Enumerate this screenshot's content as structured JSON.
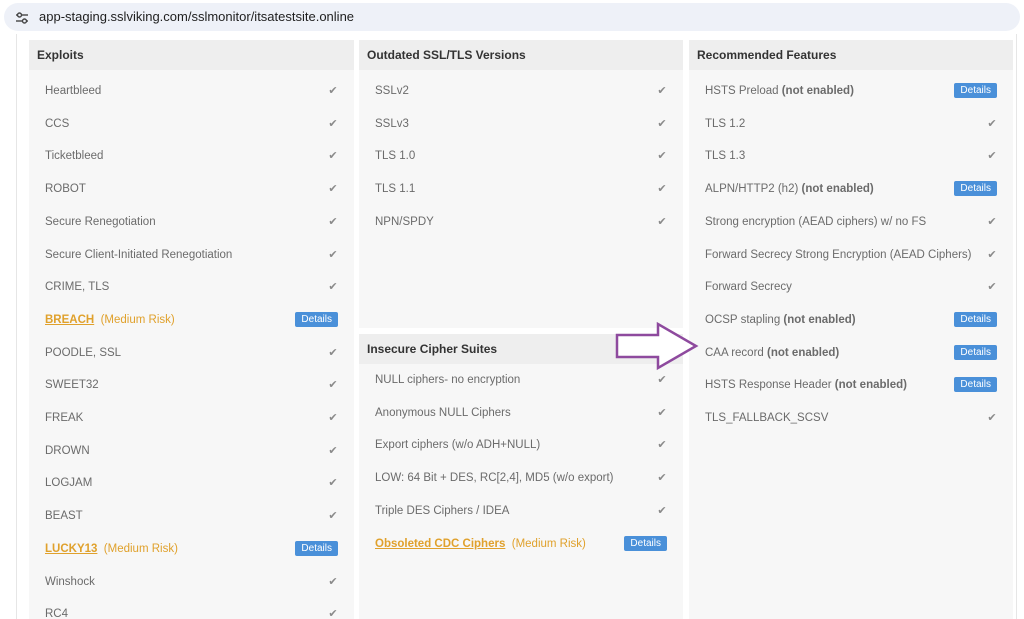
{
  "address_bar": {
    "url": "app-staging.sslviking.com/sslmonitor/itsatestsite.online"
  },
  "details_label": "Details",
  "exploits": {
    "title": "Exploits",
    "items": [
      {
        "label": "Heartbleed"
      },
      {
        "label": "CCS"
      },
      {
        "label": "Ticketbleed"
      },
      {
        "label": "ROBOT"
      },
      {
        "label": "Secure Renegotiation"
      },
      {
        "label": "Secure Client-Initiated Renegotiation"
      },
      {
        "label": "CRIME, TLS"
      },
      {
        "link": "BREACH",
        "risk": "(Medium Risk)"
      },
      {
        "label": "POODLE, SSL"
      },
      {
        "label": "SWEET32"
      },
      {
        "label": "FREAK"
      },
      {
        "label": "DROWN"
      },
      {
        "label": "LOGJAM"
      },
      {
        "label": "BEAST"
      },
      {
        "link": "LUCKY13",
        "risk": "(Medium Risk)"
      },
      {
        "label": "Winshock"
      },
      {
        "label": "RC4"
      }
    ]
  },
  "outdated": {
    "title": "Outdated SSL/TLS Versions",
    "items": [
      {
        "label": "SSLv2"
      },
      {
        "label": "SSLv3"
      },
      {
        "label": "TLS 1.0"
      },
      {
        "label": "TLS 1.1"
      },
      {
        "label": "NPN/SPDY"
      }
    ]
  },
  "insecure": {
    "title": "Insecure Cipher Suites",
    "items": [
      {
        "label": "NULL ciphers- no encryption"
      },
      {
        "label": "Anonymous NULL Ciphers"
      },
      {
        "label": "Export ciphers (w/o ADH+NULL)"
      },
      {
        "label": "LOW: 64 Bit + DES, RC[2,4], MD5 (w/o export)"
      },
      {
        "label": "Triple DES Ciphers / IDEA"
      },
      {
        "link": "Obsoleted CDC Ciphers",
        "risk": "(Medium Risk)"
      }
    ]
  },
  "recommended": {
    "title": "Recommended Features",
    "items": [
      {
        "label": "HSTS Preload",
        "status": "(not enabled)"
      },
      {
        "label": "TLS 1.2"
      },
      {
        "label": "TLS 1.3"
      },
      {
        "label": "ALPN/HTTP2 (h2)",
        "status": "(not enabled)"
      },
      {
        "label": "Strong encryption (AEAD ciphers) w/ no FS"
      },
      {
        "label": "Forward Secrecy Strong Encryption (AEAD Ciphers)"
      },
      {
        "label": "Forward Secrecy"
      },
      {
        "label": "OCSP stapling",
        "status": "(not enabled)"
      },
      {
        "label": "CAA record",
        "status": "(not enabled)"
      },
      {
        "label": "HSTS Response Header",
        "status": "(not enabled)"
      },
      {
        "label": "TLS_FALLBACK_SCSV"
      }
    ]
  },
  "icons": {
    "check": "check-icon",
    "site_info": "tune-icon",
    "annotation": "arrow-right-icon"
  },
  "colors": {
    "details_button": "#4a90d9",
    "risk": "#e0a12c",
    "arrow": "#8e4a9e",
    "panel_bg": "#f7f7f7",
    "header_bg": "#eeeeee"
  }
}
